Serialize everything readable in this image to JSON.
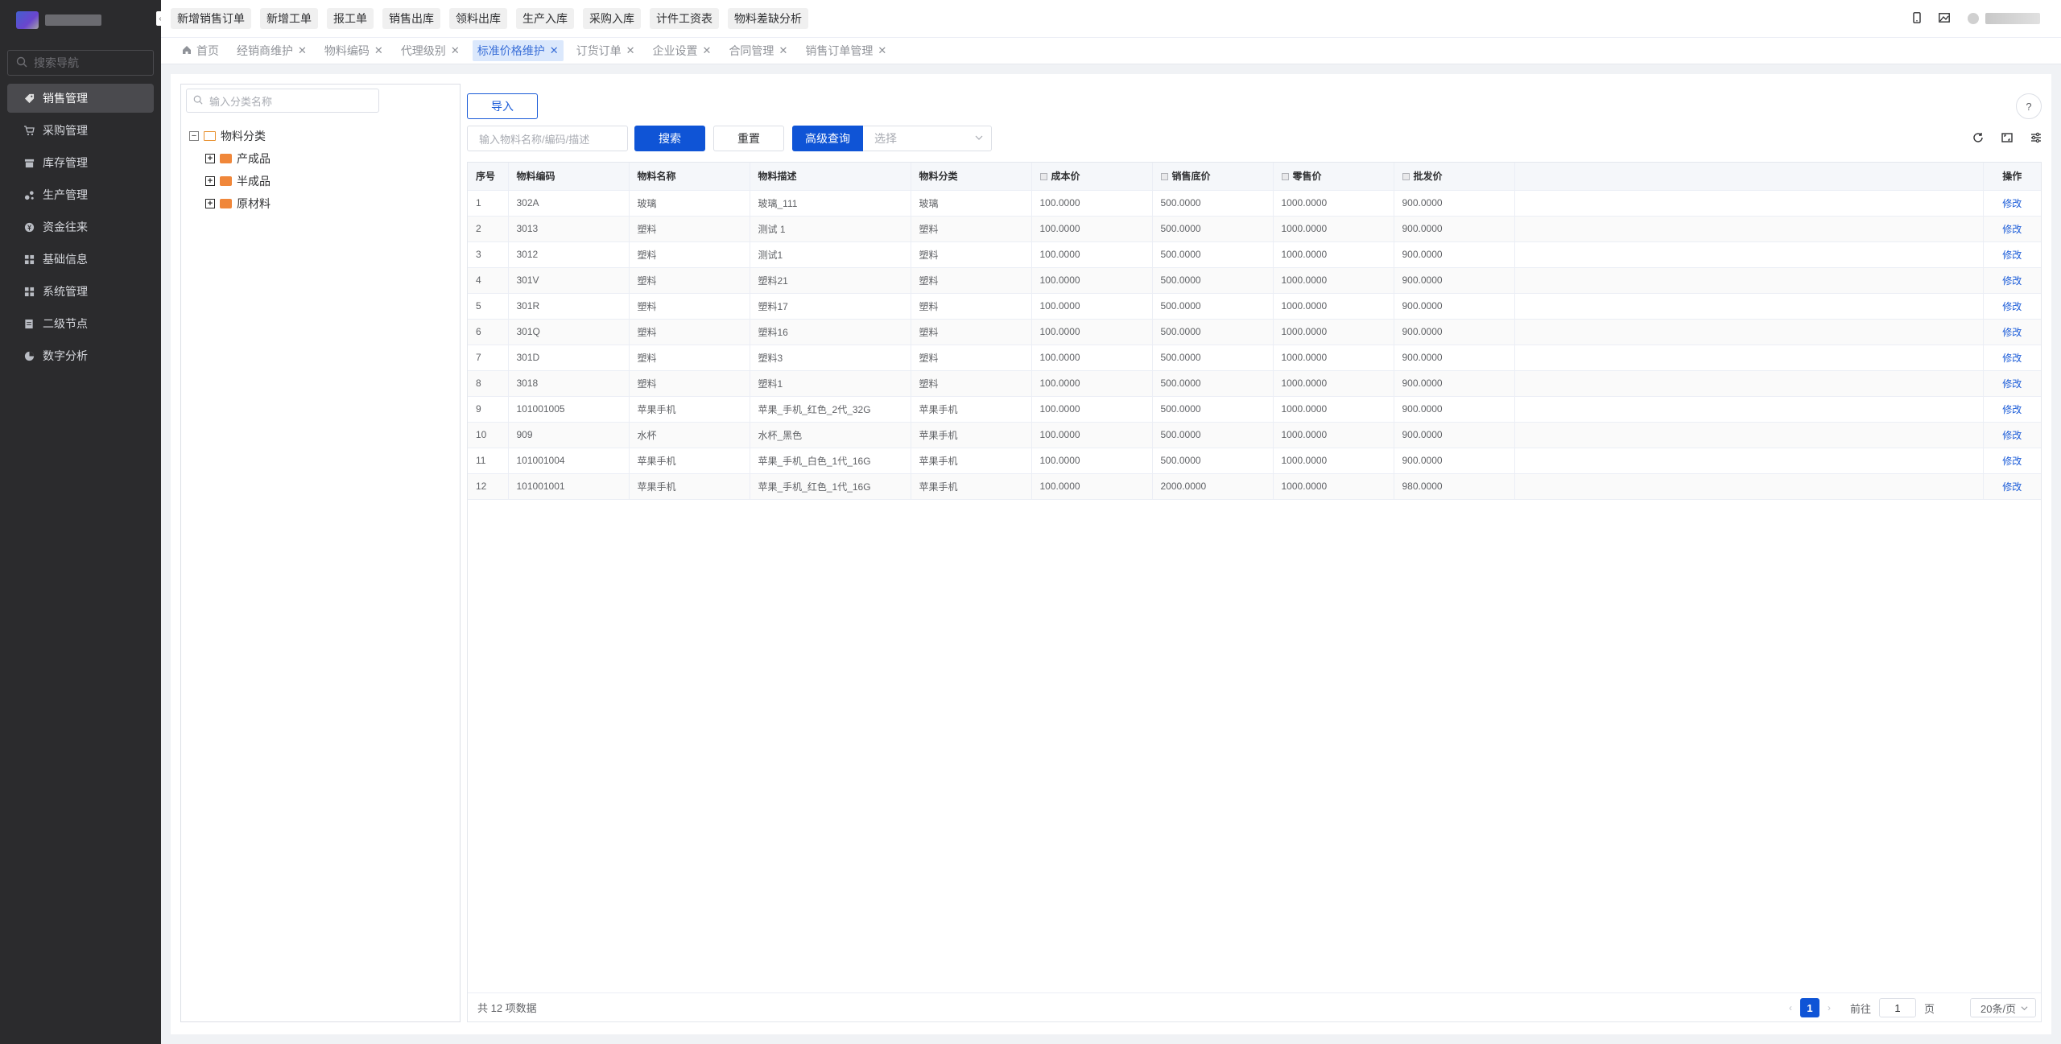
{
  "sidebar": {
    "search_placeholder": "搜索导航",
    "items": [
      {
        "label": "销售管理",
        "icon": "tag-icon",
        "active": true
      },
      {
        "label": "采购管理",
        "icon": "cart-icon",
        "active": false
      },
      {
        "label": "库存管理",
        "icon": "inventory-icon",
        "active": false
      },
      {
        "label": "生产管理",
        "icon": "production-icon",
        "active": false
      },
      {
        "label": "资金往来",
        "icon": "money-icon",
        "active": false
      },
      {
        "label": "基础信息",
        "icon": "grid-icon",
        "active": false
      },
      {
        "label": "系统管理",
        "icon": "grid-icon",
        "active": false
      },
      {
        "label": "二级节点",
        "icon": "document-icon",
        "active": false
      },
      {
        "label": "数字分析",
        "icon": "pie-chart-icon",
        "active": false
      }
    ]
  },
  "topbar": {
    "quick_buttons": [
      "新增销售订单",
      "新增工单",
      "报工单",
      "销售出库",
      "领料出库",
      "生产入库",
      "采购入库",
      "计件工资表",
      "物料差缺分析"
    ]
  },
  "tabs": [
    {
      "label": "首页",
      "closable": false,
      "active": false
    },
    {
      "label": "经销商维护",
      "closable": true,
      "active": false
    },
    {
      "label": "物料编码",
      "closable": true,
      "active": false
    },
    {
      "label": "代理级别",
      "closable": true,
      "active": false
    },
    {
      "label": "标准价格维护",
      "closable": true,
      "active": true
    },
    {
      "label": "订货订单",
      "closable": true,
      "active": false
    },
    {
      "label": "企业设置",
      "closable": true,
      "active": false
    },
    {
      "label": "合同管理",
      "closable": true,
      "active": false
    },
    {
      "label": "销售订单管理",
      "closable": true,
      "active": false
    }
  ],
  "tree": {
    "search_placeholder": "输入分类名称",
    "root": "物料分类",
    "children": [
      "产成品",
      "半成品",
      "原材料"
    ]
  },
  "toolbar": {
    "import_label": "导入",
    "search_placeholder": "输入物料名称/编码/描述",
    "search_label": "搜索",
    "reset_label": "重置",
    "advanced_label": "高级查询",
    "select_placeholder": "选择"
  },
  "table": {
    "columns": [
      "序号",
      "物料编码",
      "物料名称",
      "物料描述",
      "物料分类",
      "成本价",
      "销售底价",
      "零售价",
      "批发价",
      "",
      "操作"
    ],
    "rows": [
      [
        "1",
        "302A",
        "玻璃",
        "玻璃_111",
        "玻璃",
        "100.0000",
        "500.0000",
        "1000.0000",
        "900.0000"
      ],
      [
        "2",
        "3013",
        "塑料",
        "测试 1",
        "塑料",
        "100.0000",
        "500.0000",
        "1000.0000",
        "900.0000"
      ],
      [
        "3",
        "3012",
        "塑料",
        "测试1",
        "塑料",
        "100.0000",
        "500.0000",
        "1000.0000",
        "900.0000"
      ],
      [
        "4",
        "301V",
        "塑料",
        "塑料21",
        "塑料",
        "100.0000",
        "500.0000",
        "1000.0000",
        "900.0000"
      ],
      [
        "5",
        "301R",
        "塑料",
        "塑料17",
        "塑料",
        "100.0000",
        "500.0000",
        "1000.0000",
        "900.0000"
      ],
      [
        "6",
        "301Q",
        "塑料",
        "塑料16",
        "塑料",
        "100.0000",
        "500.0000",
        "1000.0000",
        "900.0000"
      ],
      [
        "7",
        "301D",
        "塑料",
        "塑料3",
        "塑料",
        "100.0000",
        "500.0000",
        "1000.0000",
        "900.0000"
      ],
      [
        "8",
        "3018",
        "塑料",
        "塑料1",
        "塑料",
        "100.0000",
        "500.0000",
        "1000.0000",
        "900.0000"
      ],
      [
        "9",
        "101001005",
        "苹果手机",
        "苹果_手机_红色_2代_32G",
        "苹果手机",
        "100.0000",
        "500.0000",
        "1000.0000",
        "900.0000"
      ],
      [
        "10",
        "909",
        "水杯",
        "水杯_黑色",
        "苹果手机",
        "100.0000",
        "500.0000",
        "1000.0000",
        "900.0000"
      ],
      [
        "11",
        "101001004",
        "苹果手机",
        "苹果_手机_白色_1代_16G",
        "苹果手机",
        "100.0000",
        "500.0000",
        "1000.0000",
        "900.0000"
      ],
      [
        "12",
        "101001001",
        "苹果手机",
        "苹果_手机_红色_1代_16G",
        "苹果手机",
        "100.0000",
        "2000.0000",
        "1000.0000",
        "980.0000"
      ]
    ],
    "action_label": "修改"
  },
  "footer": {
    "total_text": "共 12 项数据",
    "current_page": "1",
    "goto_label": "前往",
    "goto_value": "1",
    "page_unit": "页",
    "page_size": "20条/页"
  },
  "colors": {
    "primary": "#0f54d6",
    "sidebar_bg": "#2b2b2d",
    "active_tab_bg": "#dbe8fc"
  }
}
